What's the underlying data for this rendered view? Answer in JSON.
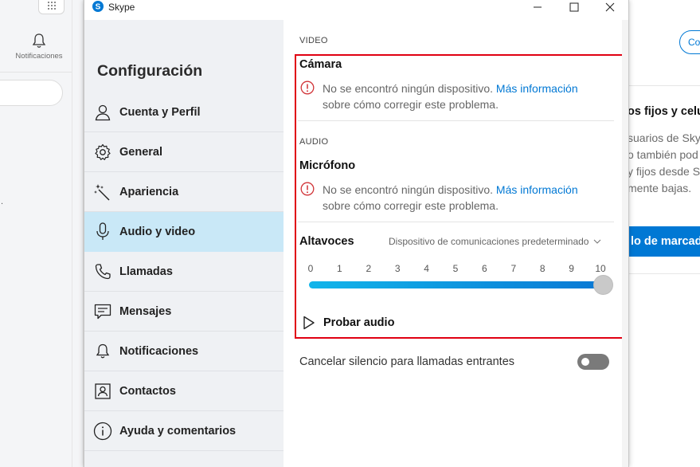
{
  "background": {
    "notifications_label": "Notificaciones",
    "right_button_text": "Co",
    "right_heading": "os fijos y celu",
    "right_paragraph": [
      "suarios de Sky",
      "o también pod",
      "y fijos desde S",
      "mente bajas."
    ],
    "right_blue_button": "lo de marcad",
    "left_dot": "."
  },
  "window": {
    "title": "Skype",
    "controls": [
      "minimize-icon",
      "maximize-icon",
      "close-icon"
    ]
  },
  "sidebar": {
    "title": "Configuración",
    "items": [
      {
        "label": "Cuenta y Perfil",
        "icon": "person-icon"
      },
      {
        "label": "General",
        "icon": "gear-icon"
      },
      {
        "label": "Apariencia",
        "icon": "magic-wand-icon"
      },
      {
        "label": "Audio y video",
        "icon": "microphone-icon",
        "active": true
      },
      {
        "label": "Llamadas",
        "icon": "phone-icon"
      },
      {
        "label": "Mensajes",
        "icon": "message-icon"
      },
      {
        "label": "Notificaciones",
        "icon": "bell-icon"
      },
      {
        "label": "Contactos",
        "icon": "contacts-icon"
      },
      {
        "label": "Ayuda y comentarios",
        "icon": "info-icon"
      }
    ]
  },
  "content": {
    "video_section": "VIDEO",
    "camera_title": "Cámara",
    "camera_warning_line1": "No se encontró ningún dispositivo.",
    "camera_warning_link": "Más información",
    "camera_warning_line2": "sobre cómo corregir este problema.",
    "audio_section": "AUDIO",
    "mic_title": "Micrófono",
    "mic_warning_line1": "No se encontró ningún dispositivo.",
    "mic_warning_link": "Más información",
    "mic_warning_line2": "sobre cómo corregir este problema.",
    "speakers_label": "Altavoces",
    "speakers_device": "Dispositivo de comunicaciones predeterminado",
    "volume_ticks": [
      "0",
      "1",
      "2",
      "3",
      "4",
      "5",
      "6",
      "7",
      "8",
      "9",
      "10"
    ],
    "volume_value": 10,
    "test_audio_label": "Probar audio",
    "unmute_label": "Cancelar silencio para llamadas entrantes",
    "unmute_enabled": false
  },
  "colors": {
    "accent": "#0078d4",
    "highlight_box": "#e00012",
    "active_item_bg": "#c9e8f7",
    "warning_red": "#d13438"
  }
}
